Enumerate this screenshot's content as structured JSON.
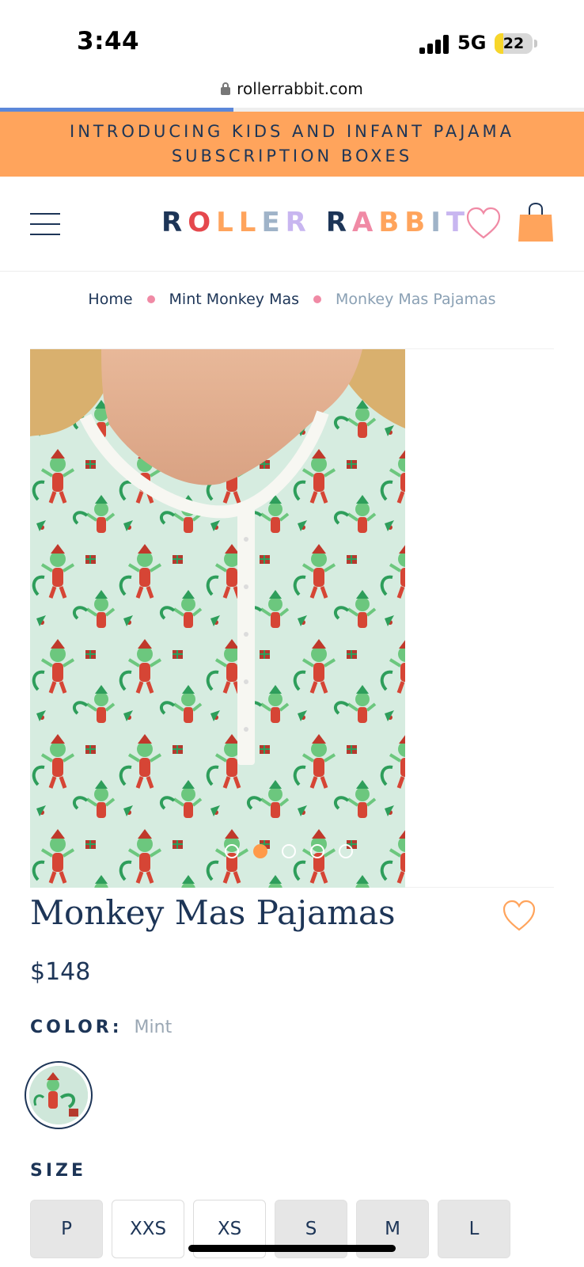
{
  "status_bar": {
    "time": "3:44",
    "network": "5G",
    "battery": "22",
    "battery_level": 0.22
  },
  "browser": {
    "url": "rollerrabbit.com",
    "load_progress": 0.4
  },
  "promo": {
    "text": "INTRODUCING KIDS AND INFANT PAJAMA SUBSCRIPTION BOXES"
  },
  "header": {
    "logo": {
      "letters": [
        {
          "char": "R",
          "color": "#1d3557"
        },
        {
          "char": "O",
          "color": "#e5484d"
        },
        {
          "char": "L",
          "color": "#ffa45c"
        },
        {
          "char": "L",
          "color": "#ffa45c"
        },
        {
          "char": "E",
          "color": "#9fb3c8"
        },
        {
          "char": "R",
          "color": "#c8b6f0"
        },
        {
          "char": " ",
          "color": "#ffffff"
        },
        {
          "char": "R",
          "color": "#1d3557"
        },
        {
          "char": "A",
          "color": "#f08aa5"
        },
        {
          "char": "B",
          "color": "#ffa45c"
        },
        {
          "char": "B",
          "color": "#ffa45c"
        },
        {
          "char": "I",
          "color": "#9fb3c8"
        },
        {
          "char": "T",
          "color": "#c8b6f0"
        }
      ]
    }
  },
  "breadcrumb": {
    "items": [
      "Home",
      "Mint Monkey Mas",
      "Monkey Mas Pajamas"
    ]
  },
  "gallery": {
    "slide_count": 5,
    "active_index": 1
  },
  "product": {
    "title": "Monkey Mas Pajamas",
    "price": "$148",
    "color_label": "COLOR:",
    "color_value": "Mint",
    "size_label": "SIZE",
    "sizes": [
      "P",
      "XXS",
      "XS",
      "S",
      "M",
      "L"
    ]
  },
  "colors": {
    "navy": "#1d3557",
    "orange": "#ffa45c",
    "pink": "#f08aa5",
    "mint": "#cfe7da"
  },
  "icons": {
    "menu": "hamburger-icon",
    "wishlist": "heart-icon",
    "cart": "shopping-bag-icon",
    "lock": "lock-icon"
  }
}
